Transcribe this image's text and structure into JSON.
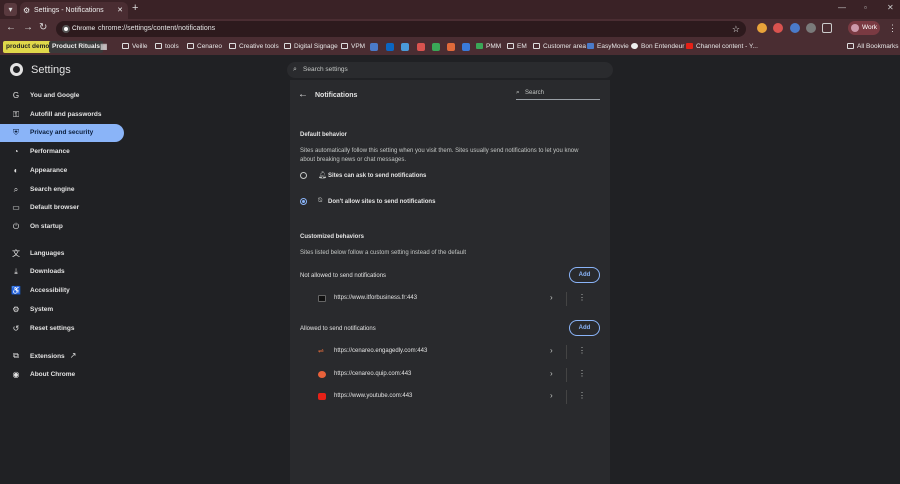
{
  "tab": {
    "title": "Settings - Notifications"
  },
  "window": {
    "minimize": "—",
    "maximize": "▫",
    "close": "✕"
  },
  "omnibox": {
    "chip": "Chrome",
    "url": "chrome://settings/content/notifications"
  },
  "profile": {
    "label": "Work"
  },
  "bookmarks": {
    "badge1": "product demo",
    "badge2": "Product Rituals",
    "items": [
      "Veille",
      "tools",
      "Cenareo",
      "Creative tools",
      "Digital Signage",
      "VPM",
      "PMM",
      "EM",
      "Customer area",
      "EasyMovie",
      "Bon Entendeur",
      "Channel content - Y..."
    ],
    "all": "All Bookmarks"
  },
  "settings": {
    "title": "Settings",
    "search_placeholder": "Search settings"
  },
  "sidebar": {
    "items": [
      {
        "label": "You and Google",
        "icon": "G"
      },
      {
        "label": "Autofill and passwords",
        "icon": "⚿"
      },
      {
        "label": "Privacy and security",
        "icon": "⛨"
      },
      {
        "label": "Performance",
        "icon": "◔"
      },
      {
        "label": "Appearance",
        "icon": "◐"
      },
      {
        "label": "Search engine",
        "icon": "⌕"
      },
      {
        "label": "Default browser",
        "icon": "▭"
      },
      {
        "label": "On startup",
        "icon": "⏻"
      },
      {
        "label": "Languages",
        "icon": "文"
      },
      {
        "label": "Downloads",
        "icon": "⤓"
      },
      {
        "label": "Accessibility",
        "icon": "♿"
      },
      {
        "label": "System",
        "icon": "⚙"
      },
      {
        "label": "Reset settings",
        "icon": "↺"
      },
      {
        "label": "Extensions",
        "icon": "⧉"
      },
      {
        "label": "About Chrome",
        "icon": "◉"
      }
    ]
  },
  "panel": {
    "title": "Notifications",
    "search_label": "Search",
    "default_behavior": {
      "heading": "Default behavior",
      "description": "Sites automatically follow this setting when you visit them. Sites usually send notifications to let you know about breaking news or chat messages.",
      "option1": "Sites can ask to send notifications",
      "option2": "Don't allow sites to send notifications",
      "selected": "option2"
    },
    "customized": {
      "heading": "Customized behaviors",
      "description": "Sites listed below follow a custom setting instead of the default",
      "not_allowed": "Not allowed to send notifications",
      "allowed": "Allowed to send notifications",
      "add_label": "Add",
      "not_allowed_sites": [
        "https://www.itforbusiness.fr:443"
      ],
      "allowed_sites": [
        "https://cenareo.engagedly.com:443",
        "https://cenareo.quip.com:443",
        "https://www.youtube.com:443"
      ]
    }
  },
  "colors": {
    "accent": "#8ab4f8",
    "frame": "#4a2d32"
  }
}
